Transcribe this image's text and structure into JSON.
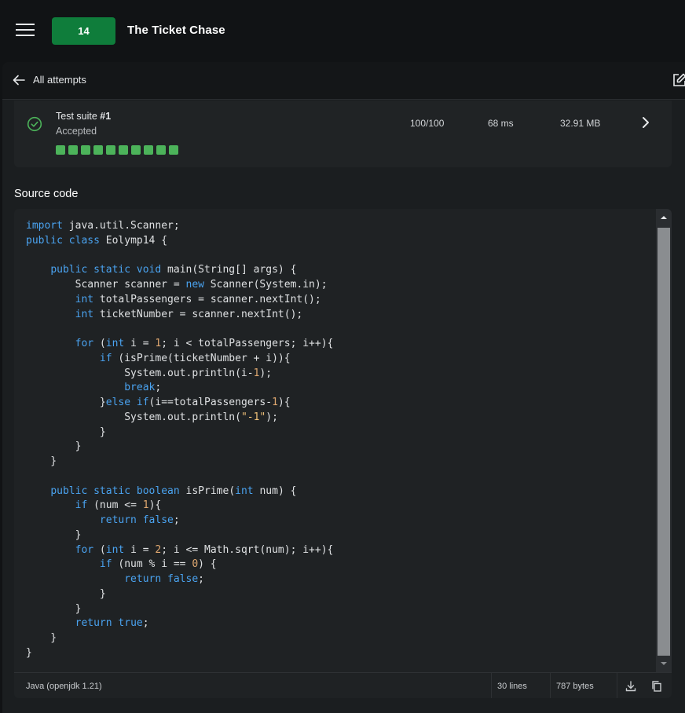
{
  "header": {
    "menu_icon": "hamburger-menu-icon",
    "problem_number": "14",
    "problem_title": "The Ticket Chase"
  },
  "submission": {
    "back_label": "All attempts",
    "edit_icon": "edit-icon"
  },
  "test_suite": {
    "title_prefix": "Test suite ",
    "title_number": "#1",
    "status": "Accepted",
    "tests_passed": 10,
    "score": "100/100",
    "time": "68 ms",
    "memory": "32.91 MB",
    "status_color": "#4cb35a"
  },
  "source": {
    "heading": "Source code",
    "language": "Java (openjdk 1.21)",
    "lines": "30 lines",
    "bytes": "787 bytes",
    "code": "import java.util.Scanner;\npublic class Eolymp14 {\n\n    public static void main(String[] args) {\n        Scanner scanner = new Scanner(System.in);\n        int totalPassengers = scanner.nextInt();\n        int ticketNumber = scanner.nextInt();\n\n        for (int i = 1; i < totalPassengers; i++){\n            if (isPrime(ticketNumber + i)){\n                System.out.println(i-1);\n                break;\n            }else if(i==totalPassengers-1){\n                System.out.println(\"-1\");\n            }\n        }\n    }\n\n    public static boolean isPrime(int num) {\n        if (num <= 1){\n            return false;\n        }\n        for (int i = 2; i <= Math.sqrt(num); i++){\n            if (num % i == 0) {\n                return false;\n            }\n        }\n        return true;\n    }\n}"
  },
  "colors": {
    "accent_green": "#0f7d3b",
    "keyword_blue": "#4aa3f0",
    "number_orange": "#e0a870",
    "background": "#111315"
  }
}
